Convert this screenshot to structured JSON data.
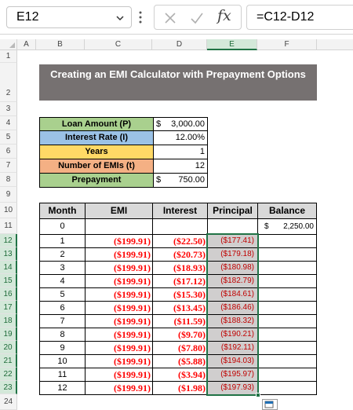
{
  "formula_bar": {
    "name_box": "E12",
    "formula": "=C12-D12",
    "fx_label": "fx"
  },
  "columns": [
    "A",
    "B",
    "C",
    "D",
    "E",
    "F"
  ],
  "rows": [
    "1",
    "2",
    "3",
    "4",
    "5",
    "6",
    "7",
    "8",
    "9",
    "10",
    "11",
    "12",
    "13",
    "14",
    "15",
    "16",
    "17",
    "18",
    "19",
    "20",
    "21",
    "22",
    "23",
    "24"
  ],
  "title": "Creating an EMI Calculator with Prepayment Options",
  "inputs": {
    "loan_amount": {
      "label": "Loan Amount (P)",
      "symbol": "$",
      "value": "3,000.00"
    },
    "interest_rate": {
      "label": "Interest Rate (I)",
      "value": "12.00%"
    },
    "years": {
      "label": "Years",
      "value": "1"
    },
    "num_emis": {
      "label": "Number of EMIs (t)",
      "value": "12"
    },
    "prepayment": {
      "label": "Prepayment",
      "symbol": "$",
      "value": "750.00"
    }
  },
  "table": {
    "headers": [
      "Month",
      "EMI",
      "Interest",
      "Principal",
      "Balance"
    ],
    "start_row": {
      "month": "0",
      "balance_symbol": "$",
      "balance": "2,250.00"
    },
    "rows": [
      {
        "month": "1",
        "emi": "($199.91)",
        "interest": "($22.50)",
        "principal": "($177.41)"
      },
      {
        "month": "2",
        "emi": "($199.91)",
        "interest": "($20.73)",
        "principal": "($179.18)"
      },
      {
        "month": "3",
        "emi": "($199.91)",
        "interest": "($18.93)",
        "principal": "($180.98)"
      },
      {
        "month": "4",
        "emi": "($199.91)",
        "interest": "($17.12)",
        "principal": "($182.79)"
      },
      {
        "month": "5",
        "emi": "($199.91)",
        "interest": "($15.30)",
        "principal": "($184.61)"
      },
      {
        "month": "6",
        "emi": "($199.91)",
        "interest": "($13.45)",
        "principal": "($186.46)"
      },
      {
        "month": "7",
        "emi": "($199.91)",
        "interest": "($11.59)",
        "principal": "($188.32)"
      },
      {
        "month": "8",
        "emi": "($199.91)",
        "interest": "($9.70)",
        "principal": "($190.21)"
      },
      {
        "month": "9",
        "emi": "($199.91)",
        "interest": "($7.80)",
        "principal": "($192.11)"
      },
      {
        "month": "10",
        "emi": "($199.91)",
        "interest": "($5.88)",
        "principal": "($194.03)"
      },
      {
        "month": "11",
        "emi": "($199.91)",
        "interest": "($3.94)",
        "principal": "($195.97)"
      },
      {
        "month": "12",
        "emi": "($199.91)",
        "interest": "($1.98)",
        "principal": "($197.93)"
      }
    ]
  },
  "colors": {
    "excel_green": "#217346",
    "title_bg": "#767171",
    "negative_red": "#ff0000"
  }
}
